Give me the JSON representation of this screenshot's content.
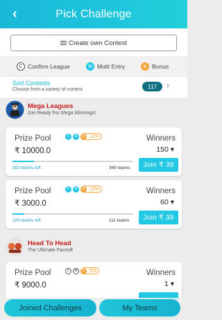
{
  "header": {
    "title": "Pick Challenge",
    "back_icon": "back-arrow-icon"
  },
  "create_contest": {
    "label": "Create own Contest",
    "icon": "list-icon"
  },
  "legend": {
    "confirm": {
      "symbol": "C",
      "label": "Confirm League"
    },
    "multi": {
      "symbol": "M",
      "label": "Multi Entry"
    },
    "bonus": {
      "symbol": "B",
      "label": "Bonus"
    }
  },
  "sort": {
    "title": "Sort Contests",
    "subtitle": "Choose from a variety of contest",
    "count": "117",
    "chevron_icon": "chevron-right-icon"
  },
  "sections": [
    {
      "title": "Mega Leagues",
      "subtitle": "Get Ready For Mega Winnings!",
      "icon": "mega-league-icon",
      "cards": [
        {
          "prize_label": "Prize Pool",
          "prize": "₹ 10000.0",
          "tags": [
            "C",
            "M",
            "B"
          ],
          "bonus_pct": "10%",
          "winners_label": "Winners",
          "winners": "150 ▾",
          "teams_left": "303 teams left",
          "total_teams": "369 teams",
          "fill_fraction": 0.18,
          "join_label": "Join  ₹ 39"
        },
        {
          "prize_label": "Prize Pool",
          "prize": "₹ 3000.0",
          "tags": [
            "C",
            "M",
            "B"
          ],
          "bonus_pct": "10%",
          "winners_label": "Winners",
          "winners": "60 ▾",
          "teams_left": "100 teams left",
          "total_teams": "111 teams",
          "fill_fraction": 0.1,
          "join_label": "Join  ₹ 39"
        }
      ]
    },
    {
      "title": "Head To Head",
      "subtitle": "The Ultimate Faceoff",
      "icon": "head-to-head-icon",
      "cards": [
        {
          "prize_label": "Prize Pool",
          "prize": "₹ 9000.0",
          "tags": [
            "C",
            "M",
            "B"
          ],
          "bonus_pct": "5%",
          "winners_label": "Winners",
          "winners": "1 ▾"
        }
      ]
    }
  ],
  "bottom_nav": {
    "joined": "Joined Challenges",
    "teams": "My Teams"
  },
  "colors": {
    "accent": "#1fc6e6",
    "bonus": "#f2a33a",
    "section_title": "#c21d1d",
    "badge": "#0f6f83"
  }
}
